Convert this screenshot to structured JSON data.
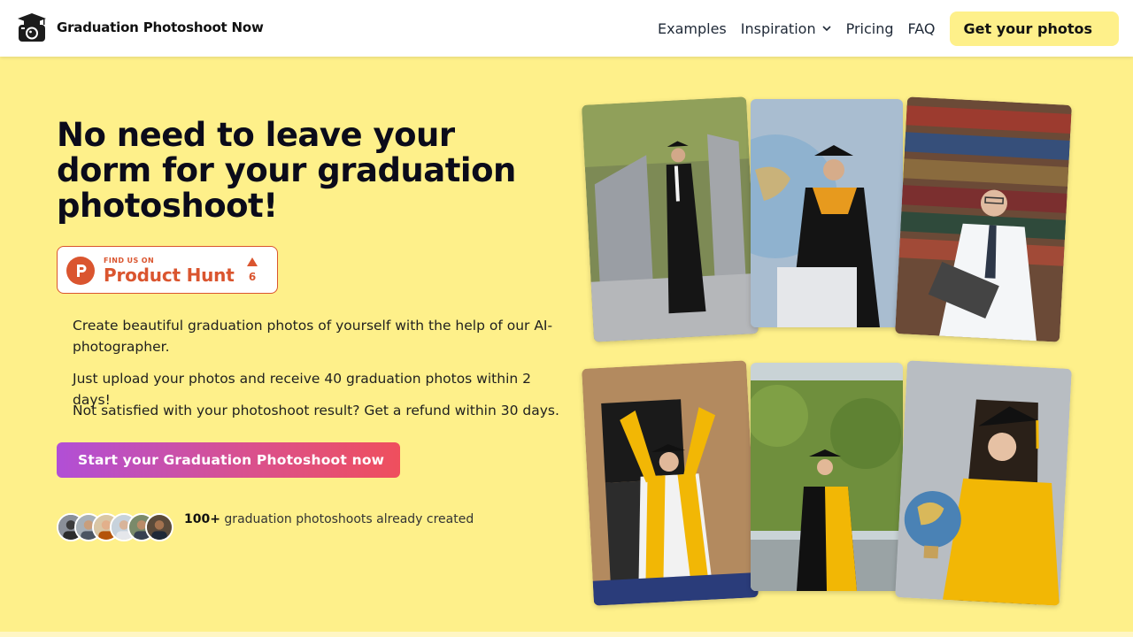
{
  "header": {
    "brand": "Graduation Photoshoot Now",
    "nav": [
      {
        "label": "Examples"
      },
      {
        "label": "Inspiration"
      },
      {
        "label": "Pricing"
      },
      {
        "label": "FAQ"
      }
    ],
    "cta_label": "Get your photos"
  },
  "hero": {
    "headline": "No need to leave your dorm for your graduation photoshoot!",
    "product_hunt": {
      "small_label": "FIND US ON",
      "name": "Product Hunt",
      "count": "6"
    },
    "paragraphs": [
      "Create beautiful graduation photos of yourself with the help of our AI-photographer.",
      "Just upload your photos and receive 40 graduation photos within 2 days!",
      "Not satisfied with your photoshoot result? Get a refund within 30 days."
    ],
    "cta_label": "Start your Graduation Photoshoot now",
    "social_count": "100+",
    "social_text": "graduation photoshoots already created"
  },
  "colors": {
    "background": "#fef08a",
    "accent": "#fef08a",
    "product_hunt": "#da552f",
    "cta_gradient_start": "#b14fd6",
    "cta_gradient_end": "#ef4f5d"
  },
  "icons": [
    "graduation-camera-logo-icon",
    "chevron-down-icon",
    "product-hunt-logo-icon",
    "upvote-arrow-icon"
  ]
}
